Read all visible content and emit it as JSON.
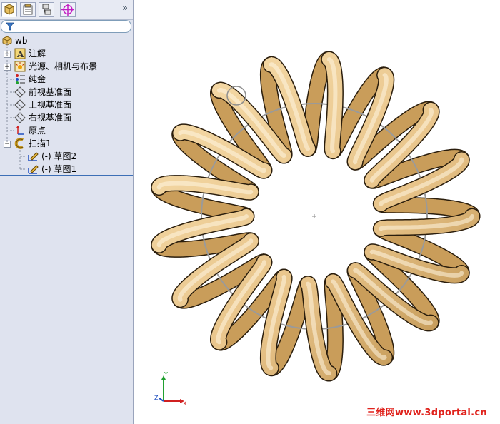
{
  "feature_tree": {
    "root": {
      "label": "wb",
      "icon": "part-icon"
    },
    "items": [
      {
        "label": "注解",
        "icon": "annotation-icon",
        "expandable": true
      },
      {
        "label": "光源、相机与布景",
        "icon": "lights-cameras-scene-icon",
        "expandable": true
      },
      {
        "label": "纯金",
        "icon": "material-icon",
        "expandable": false
      },
      {
        "label": "前视基准面",
        "icon": "plane-icon",
        "expandable": false
      },
      {
        "label": "上视基准面",
        "icon": "plane-icon",
        "expandable": false
      },
      {
        "label": "右视基准面",
        "icon": "plane-icon",
        "expandable": false
      },
      {
        "label": "原点",
        "icon": "origin-icon",
        "expandable": false
      },
      {
        "label": "扫描1",
        "icon": "sweep-feature-icon",
        "expandable": true,
        "expanded": true
      },
      {
        "label": "(-) 草图2",
        "icon": "sketch-icon",
        "child": true
      },
      {
        "label": "(-) 草图1",
        "icon": "sketch-icon",
        "child": true
      }
    ]
  },
  "tabs": [
    {
      "icon": "feature-manager-icon"
    },
    {
      "icon": "property-manager-icon"
    },
    {
      "icon": "configuration-manager-icon"
    },
    {
      "icon": "dimxpert-manager-icon"
    }
  ],
  "viewport": {
    "model": "helical-coil-torus",
    "coil_color": "#e8c48a",
    "coil_turns": 17,
    "axes": {
      "x": "X",
      "y": "Y",
      "z": "Z"
    },
    "watermark": "三维网www.3dportal.cn"
  }
}
